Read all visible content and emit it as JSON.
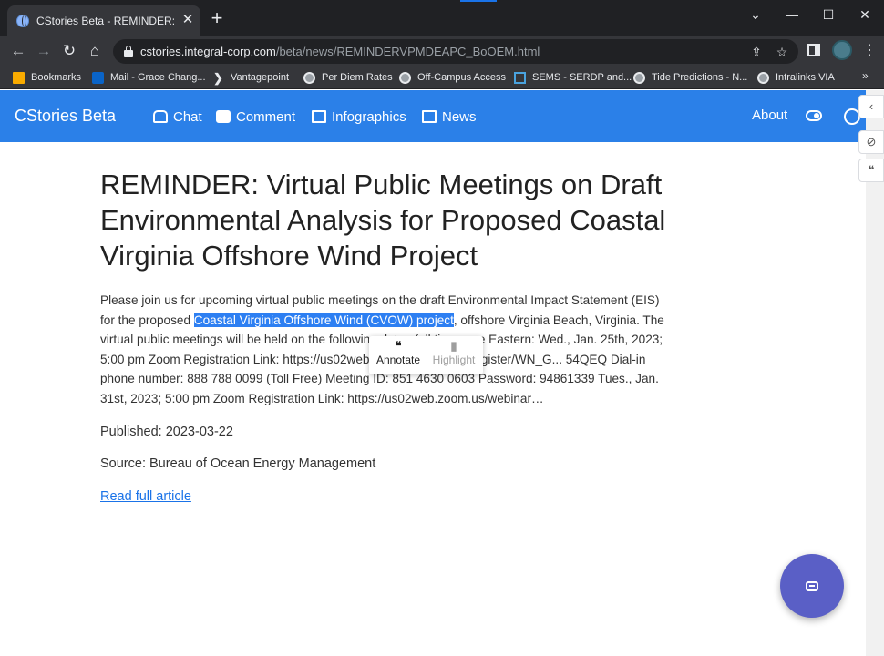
{
  "browser": {
    "tab_title": "CStories Beta - REMINDER: Virtu",
    "tab_close": "✕",
    "new_tab": "+",
    "url_host": "cstories.integral-corp.com",
    "url_path": "/beta/news/REMINDERVPMDEAPC_BoOEM.html",
    "window_controls": {
      "minimize": "—",
      "maximize": "☐",
      "close": "✕",
      "dropdown": "⌄"
    }
  },
  "bookmarks": [
    {
      "label": "Bookmarks",
      "icon": "folder-icon"
    },
    {
      "label": "Mail - Grace Chang...",
      "icon": "outlook-icon"
    },
    {
      "label": "Vantagepoint",
      "icon": "chevron-icon"
    },
    {
      "label": "Per Diem Rates",
      "icon": "globe-icon"
    },
    {
      "label": "Off-Campus Access",
      "icon": "globe-icon"
    },
    {
      "label": "SEMS - SERDP and...",
      "icon": "sems-icon"
    },
    {
      "label": "Tide Predictions - N...",
      "icon": "globe-icon"
    },
    {
      "label": "Intralinks VIA",
      "icon": "globe-icon"
    }
  ],
  "bookmarks_more": "»",
  "site": {
    "brand": "CStories Beta",
    "nav": [
      {
        "label": "Chat",
        "icon": "chat-icon"
      },
      {
        "label": "Comment",
        "icon": "comment-icon"
      },
      {
        "label": "Infographics",
        "icon": "image-icon"
      },
      {
        "label": "News",
        "icon": "news-icon"
      }
    ],
    "about": "About"
  },
  "article": {
    "title": "REMINDER: Virtual Public Meetings on Draft Environmental Analysis for Proposed Coastal Virginia Offshore Wind Project",
    "body_before": "Please join us for upcoming virtual public meetings on the draft Environmental Impact Statement (EIS) for the proposed ",
    "body_selected": "Coastal Virginia Offshore Wind (CVOW) project",
    "body_after": ", offshore Virginia Beach, Virginia. The virtual public meetings will be held on the following dates (all times are Eastern: Wed., Jan. 25th, 2023; 5:00 pm Zoom Registration Link: https://us02web.zoom.us/webinar/register/WN_G... 54QEQ Dial-in phone number: 888 788 0099 (Toll Free) Meeting ID: 851 4630 0603 Password: 94861339 Tues., Jan. 31st, 2023; 5:00 pm Zoom Registration Link: https://us02web.zoom.us/webinar…",
    "published": "Published: 2023-03-22",
    "source": "Source: Bureau of Ocean Energy Management",
    "read_more": "Read full article"
  },
  "popup": {
    "annotate": "Annotate",
    "highlight": "Highlight"
  },
  "colors": {
    "navbar": "#2b80e8",
    "selection": "#2d7ff2",
    "fab": "#5a5fc6",
    "link": "#1a73e8"
  }
}
